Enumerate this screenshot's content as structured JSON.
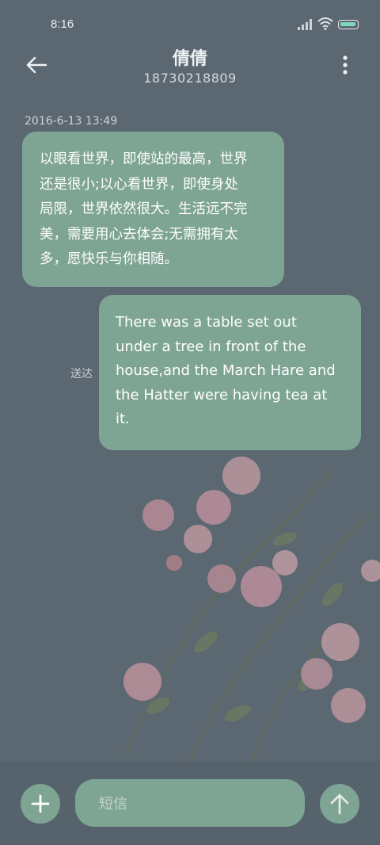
{
  "status_bar": {
    "time": "8:16",
    "icons": [
      "signal-icon",
      "wifi-icon",
      "battery-icon"
    ]
  },
  "header": {
    "contact_name": "倩倩",
    "contact_number": "18730218809",
    "icons": [
      "back-arrow-icon",
      "more-vertical-icon"
    ]
  },
  "conversation": {
    "timestamp": "2016-6-13 13:49",
    "messages": [
      {
        "direction": "incoming",
        "lines": [
          "以眼看世界，即使站的最高，世界",
          "还是很小;以心看世界，即使身处",
          "局限，世界依然很大。生活远不完",
          "美，需要用心去体会;无需拥有太",
          "多，愿快乐与你相随。"
        ]
      },
      {
        "direction": "outgoing",
        "lines": [
          "There was a table set out",
          "under a tree in front of the",
          "house,and the March Hare and",
          "the Hatter were having tea at",
          "it."
        ],
        "status": "送达"
      }
    ]
  },
  "composer": {
    "placeholder": "短信",
    "icons": [
      "plus-icon",
      "send-arrow-icon"
    ]
  },
  "colors": {
    "background": "#5b6872",
    "bubble": "#7ea494",
    "accent_text": "#ffffff"
  }
}
